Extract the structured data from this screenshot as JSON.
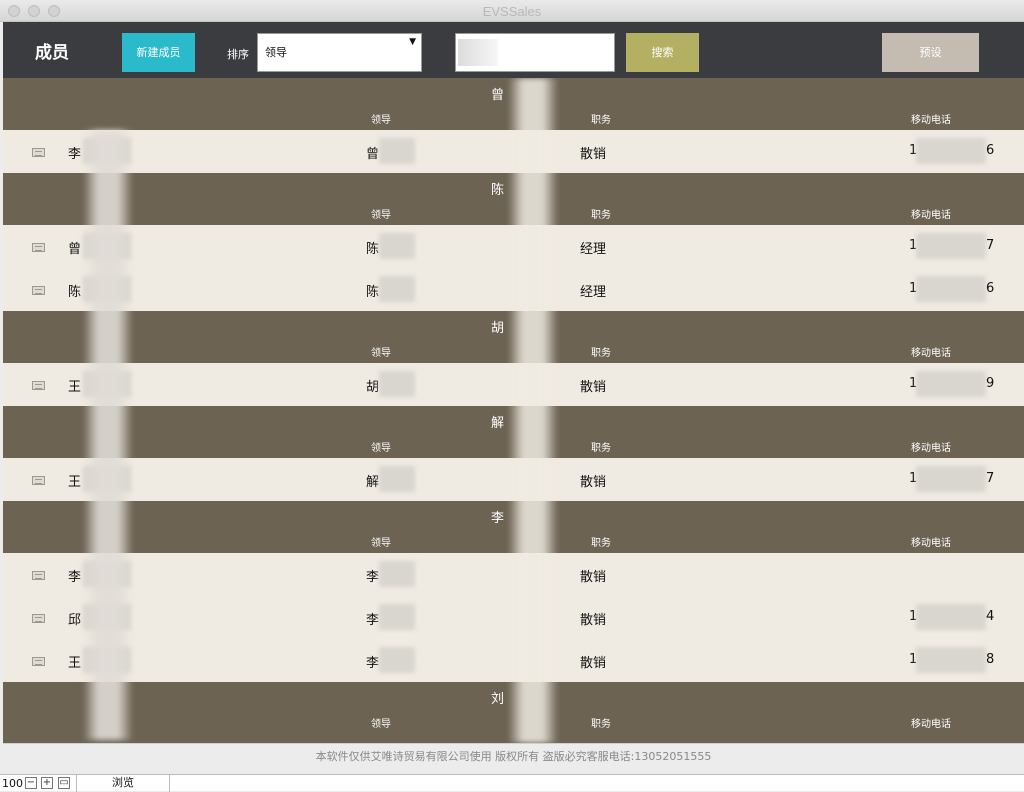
{
  "window": {
    "title": "EVSSales"
  },
  "toolbar": {
    "title": "成员",
    "new_button": "新建成员",
    "sort_label": "排序",
    "sort_value": "领导",
    "sort_arrow": "▼",
    "search_button": "搜索",
    "preset_button": "预设"
  },
  "columns": {
    "leader": "领导",
    "role": "职务",
    "phone": "移动电话"
  },
  "groups": [
    {
      "name": "曾",
      "rows": [
        {
          "name": "李",
          "leader": "曾",
          "role": "散销",
          "phone_start": "1",
          "phone_end": "6"
        }
      ]
    },
    {
      "name": "陈",
      "rows": [
        {
          "name": "曾",
          "leader": "陈",
          "role": "经理",
          "phone_start": "1",
          "phone_end": "7"
        },
        {
          "name": "陈",
          "leader": "陈",
          "role": "经理",
          "phone_start": "1",
          "phone_end": "6"
        }
      ]
    },
    {
      "name": "胡",
      "rows": [
        {
          "name": "王",
          "leader": "胡",
          "role": "散销",
          "phone_start": "1",
          "phone_end": "9"
        }
      ]
    },
    {
      "name": "解",
      "rows": [
        {
          "name": "王",
          "leader": "解",
          "role": "散销",
          "phone_start": "1",
          "phone_end": "7"
        }
      ]
    },
    {
      "name": "李",
      "rows": [
        {
          "name": "李",
          "leader": "李",
          "role": "散销",
          "phone_start": "",
          "phone_end": ""
        },
        {
          "name": "邱",
          "leader": "李",
          "role": "散销",
          "phone_start": "1",
          "phone_end": "4"
        },
        {
          "name": "王",
          "leader": "李",
          "role": "散销",
          "phone_start": "1",
          "phone_end": "8"
        }
      ]
    },
    {
      "name": "刘",
      "rows": []
    }
  ],
  "footer": {
    "text": "本软件仅供艾唯诗贸易有限公司使用 版权所有 盗版必究客服电话:13052051555"
  },
  "statusbar": {
    "zoom": "100",
    "mode": "浏览"
  }
}
